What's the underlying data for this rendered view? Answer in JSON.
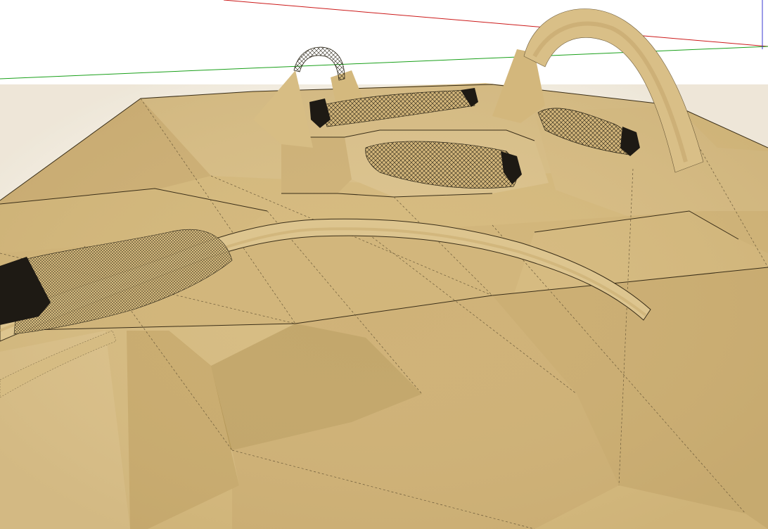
{
  "viewport": {
    "background_color": "#ffffff",
    "sky_color": "#ffffff"
  },
  "axes": {
    "red_axis_color": "#cc1a1a",
    "green_axis_color": "#1aa01a",
    "blue_axis_color": "#3a3ad0"
  },
  "materials": {
    "sand_base": "#d9bf86",
    "sand_light": "#e6cf9a",
    "sand_mid": "#ceb276",
    "sand_dark": "#b89b60",
    "sand_shadow": "#a98c53",
    "edge_color": "#3a2e18",
    "hidden_edge_color": "#6b5a3a",
    "tunnel_opening": "#1e1a14",
    "wire_mesh": "#2a2416"
  },
  "model": {
    "surface": "terrain-surface",
    "objects": [
      "large-arch-right",
      "small-arch-back",
      "foreground-tube-arch",
      "tunnel-back-center",
      "tunnel-right",
      "tunnel-middle",
      "tunnel-left"
    ]
  }
}
